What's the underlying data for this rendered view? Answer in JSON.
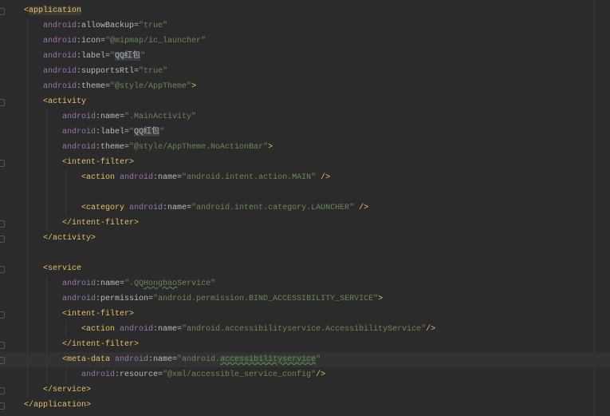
{
  "editor": {
    "current_line": 23,
    "lines": [
      {
        "indent": 1,
        "fold": true,
        "tokens": [
          {
            "t": "<",
            "c": "tag"
          },
          {
            "t": "application",
            "c": "tag hl-tag"
          }
        ]
      },
      {
        "indent": 2,
        "tokens": [
          {
            "t": "android",
            "c": "ns"
          },
          {
            "t": ":allowBackup=",
            "c": "attr"
          },
          {
            "t": "\"true\"",
            "c": "val"
          }
        ]
      },
      {
        "indent": 2,
        "tokens": [
          {
            "t": "android",
            "c": "ns"
          },
          {
            "t": ":icon=",
            "c": "attr"
          },
          {
            "t": "\"@mipmap/ic_launcher\"",
            "c": "val"
          }
        ]
      },
      {
        "indent": 2,
        "tokens": [
          {
            "t": "android",
            "c": "ns"
          },
          {
            "t": ":label=",
            "c": "attr"
          },
          {
            "t": "\"",
            "c": "val"
          },
          {
            "t": "QQ红包",
            "c": "hl-val"
          },
          {
            "t": "\"",
            "c": "val"
          }
        ]
      },
      {
        "indent": 2,
        "tokens": [
          {
            "t": "android",
            "c": "ns"
          },
          {
            "t": ":supportsRtl=",
            "c": "attr"
          },
          {
            "t": "\"true\"",
            "c": "val"
          }
        ]
      },
      {
        "indent": 2,
        "tokens": [
          {
            "t": "android",
            "c": "ns"
          },
          {
            "t": ":theme=",
            "c": "attr"
          },
          {
            "t": "\"@style/AppTheme\"",
            "c": "val"
          },
          {
            "t": ">",
            "c": "tag"
          }
        ]
      },
      {
        "indent": 2,
        "fold": true,
        "tokens": [
          {
            "t": "<activity",
            "c": "tag"
          }
        ]
      },
      {
        "indent": 3,
        "tokens": [
          {
            "t": "android",
            "c": "ns"
          },
          {
            "t": ":name=",
            "c": "attr"
          },
          {
            "t": "\".MainActivity\"",
            "c": "val"
          }
        ]
      },
      {
        "indent": 3,
        "tokens": [
          {
            "t": "android",
            "c": "ns"
          },
          {
            "t": ":label=",
            "c": "attr"
          },
          {
            "t": "\"",
            "c": "val"
          },
          {
            "t": "QQ红包",
            "c": "hl-val"
          },
          {
            "t": "\"",
            "c": "val"
          }
        ]
      },
      {
        "indent": 3,
        "tokens": [
          {
            "t": "android",
            "c": "ns"
          },
          {
            "t": ":theme=",
            "c": "attr"
          },
          {
            "t": "\"@style/AppTheme.NoActionBar\"",
            "c": "val"
          },
          {
            "t": ">",
            "c": "tag"
          }
        ]
      },
      {
        "indent": 3,
        "fold": true,
        "tokens": [
          {
            "t": "<intent-filter>",
            "c": "tag"
          }
        ]
      },
      {
        "indent": 4,
        "tokens": [
          {
            "t": "<action ",
            "c": "tag"
          },
          {
            "t": "android",
            "c": "ns"
          },
          {
            "t": ":name=",
            "c": "attr"
          },
          {
            "t": "\"android.intent.action.MAIN\"",
            "c": "val"
          },
          {
            "t": " />",
            "c": "tag"
          }
        ]
      },
      {
        "indent": 4,
        "tokens": []
      },
      {
        "indent": 4,
        "tokens": [
          {
            "t": "<category ",
            "c": "tag"
          },
          {
            "t": "android",
            "c": "ns"
          },
          {
            "t": ":name=",
            "c": "attr"
          },
          {
            "t": "\"android.intent.category.LAUNCHER\"",
            "c": "val"
          },
          {
            "t": " />",
            "c": "tag"
          }
        ]
      },
      {
        "indent": 3,
        "fold": true,
        "tokens": [
          {
            "t": "</intent-filter>",
            "c": "tag"
          }
        ]
      },
      {
        "indent": 2,
        "fold": true,
        "tokens": [
          {
            "t": "</activity>",
            "c": "tag"
          }
        ]
      },
      {
        "indent": 2,
        "tokens": []
      },
      {
        "indent": 2,
        "fold": true,
        "tokens": [
          {
            "t": "<service",
            "c": "tag"
          }
        ]
      },
      {
        "indent": 3,
        "tokens": [
          {
            "t": "android",
            "c": "ns"
          },
          {
            "t": ":name=",
            "c": "attr"
          },
          {
            "t": "\".QQ",
            "c": "val"
          },
          {
            "t": "Hongbao",
            "c": "val spell"
          },
          {
            "t": "Service\"",
            "c": "val"
          }
        ]
      },
      {
        "indent": 3,
        "tokens": [
          {
            "t": "android",
            "c": "ns"
          },
          {
            "t": ":permission=",
            "c": "attr"
          },
          {
            "t": "\"android.permission.BIND_ACCESSIBILITY_SERVICE\"",
            "c": "val"
          },
          {
            "t": ">",
            "c": "tag"
          }
        ]
      },
      {
        "indent": 3,
        "fold": true,
        "tokens": [
          {
            "t": "<intent-filter>",
            "c": "tag"
          }
        ]
      },
      {
        "indent": 4,
        "tokens": [
          {
            "t": "<action ",
            "c": "tag"
          },
          {
            "t": "android",
            "c": "ns"
          },
          {
            "t": ":name=",
            "c": "attr"
          },
          {
            "t": "\"android.accessibilityservice.AccessibilityService\"",
            "c": "val"
          },
          {
            "t": "/>",
            "c": "tag"
          }
        ]
      },
      {
        "indent": 3,
        "fold": true,
        "tokens": [
          {
            "t": "</intent-filter>",
            "c": "tag"
          }
        ]
      },
      {
        "indent": 3,
        "fold": true,
        "tokens": [
          {
            "t": "<meta-data ",
            "c": "tag"
          },
          {
            "t": "android",
            "c": "ns"
          },
          {
            "t": ":name=",
            "c": "attr"
          },
          {
            "t": "\"android.",
            "c": "val"
          },
          {
            "t": "accessibilityservice",
            "c": "val spell hl-green"
          },
          {
            "t": "\"",
            "c": "val"
          }
        ]
      },
      {
        "indent": 4,
        "tokens": [
          {
            "t": "android",
            "c": "ns"
          },
          {
            "t": ":resource=",
            "c": "attr"
          },
          {
            "t": "\"@xml/accessible_service_config\"",
            "c": "val"
          },
          {
            "t": "/>",
            "c": "tag"
          }
        ]
      },
      {
        "indent": 2,
        "fold": true,
        "tokens": [
          {
            "t": "</service>",
            "c": "tag"
          }
        ]
      },
      {
        "indent": 1,
        "fold": true,
        "tokens": [
          {
            "t": "</application>",
            "c": "tag"
          }
        ]
      }
    ]
  }
}
